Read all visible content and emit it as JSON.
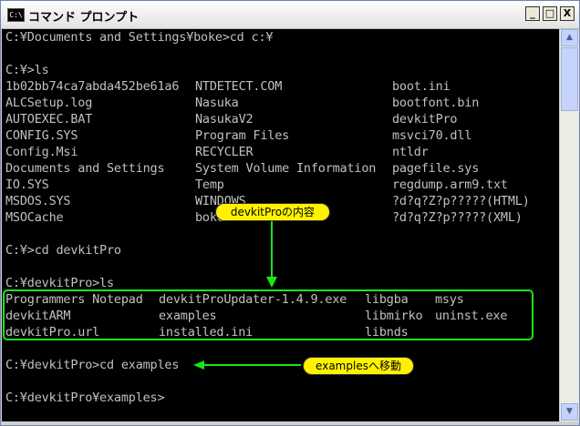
{
  "window": {
    "title": "コマンド プロンプト",
    "icon_label": "C:\\",
    "buttons": {
      "minimize": "_",
      "maximize": "□",
      "close": "X"
    }
  },
  "console": {
    "line1": "C:¥Documents and Settings¥boke>cd c:¥",
    "line2": "C:¥>ls",
    "ls_root": [
      [
        "1b02bb74ca7abda452be61a6",
        "NTDETECT.COM",
        "boot.ini"
      ],
      [
        "ALCSetup.log",
        "Nasuka",
        "bootfont.bin"
      ],
      [
        "AUTOEXEC.BAT",
        "NasukaV2",
        "devkitPro"
      ],
      [
        "CONFIG.SYS",
        "Program Files",
        "msvci70.dll"
      ],
      [
        "Config.Msi",
        "RECYCLER",
        "ntldr"
      ],
      [
        "Documents and Settings",
        "System Volume Information",
        "pagefile.sys"
      ],
      [
        "IO.SYS",
        "Temp",
        "regdump.arm9.txt"
      ],
      [
        "MSDOS.SYS",
        "WINDOWS",
        "?d?q?Z?p?????(HTML)"
      ],
      [
        "MSOCache",
        "boke",
        "?d?q?Z?p?????(XML)"
      ]
    ],
    "line3": "C:¥>cd devkitPro",
    "line4": "C:¥devkitPro>ls",
    "ls_devkit": [
      [
        "Programmers Notepad",
        "devkitProUpdater-1.4.9.exe",
        "libgba",
        "msys"
      ],
      [
        "devkitARM",
        "examples",
        "libmirko",
        "uninst.exe"
      ],
      [
        "devkitPro.url",
        "installed.ini",
        "libnds",
        ""
      ]
    ],
    "line5": "C:¥devkitPro>cd examples",
    "line6": "C:¥devkitPro¥examples>"
  },
  "annotations": {
    "devkit_contents": "devkitProの内容",
    "move_to_examples": "examplesへ移動"
  },
  "colors": {
    "console_bg": "#000000",
    "console_text": "#c0c0c0",
    "callout_fill": "#fff200",
    "highlight_green": "#19e619"
  }
}
